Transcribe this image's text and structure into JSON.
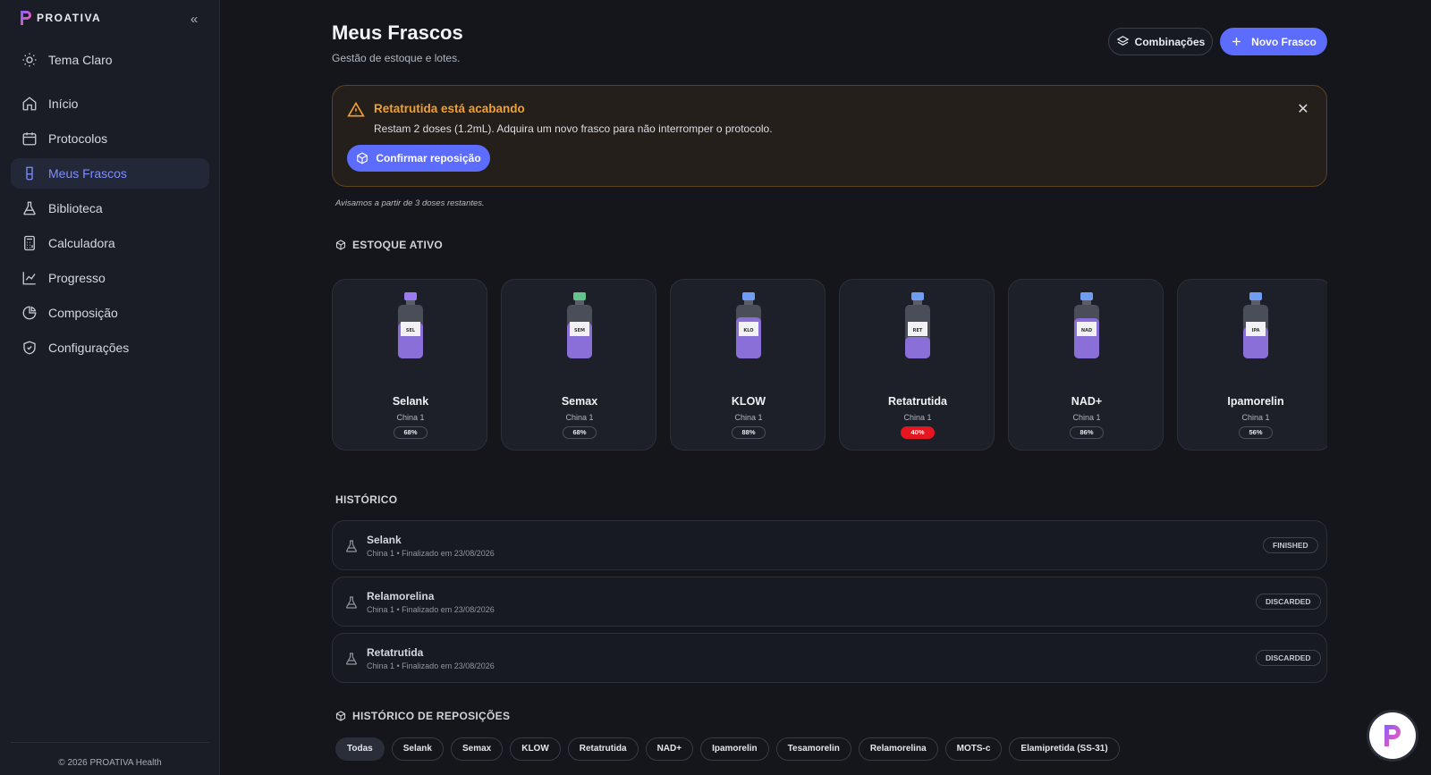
{
  "brand": {
    "name": "PROATIVA"
  },
  "sidebar": {
    "theme_toggle": "Tema Claro",
    "items": [
      {
        "label": "Início",
        "icon": "home-icon"
      },
      {
        "label": "Protocolos",
        "icon": "calendar-icon"
      },
      {
        "label": "Meus Frascos",
        "icon": "vial-icon",
        "active": true
      },
      {
        "label": "Biblioteca",
        "icon": "flask-icon"
      },
      {
        "label": "Calculadora",
        "icon": "calculator-icon"
      },
      {
        "label": "Progresso",
        "icon": "chart-line-icon"
      },
      {
        "label": "Composição",
        "icon": "pie-chart-icon"
      },
      {
        "label": "Configurações",
        "icon": "shield-icon"
      }
    ],
    "copyright": "© 2026 PROATIVA Health"
  },
  "header": {
    "title": "Meus Frascos",
    "subtitle": "Gestão de estoque e lotes.",
    "combo_button": "Combinações",
    "new_button": "Novo Frasco"
  },
  "alert": {
    "title": "Retatrutida está acabando",
    "text": "Restam 2 doses (1.2mL). Adquira um novo frasco para não interromper o protocolo.",
    "confirm_button": "Confirmar reposição",
    "note": "Avisamos a partir de 3 doses restantes.",
    "color": "#f0a02e"
  },
  "active_stock": {
    "label": "ESTOQUE ATIVO",
    "vials": [
      {
        "name": "Selank",
        "label": "SEL",
        "origin": "China 1",
        "level": "68%",
        "cap_color": "#9b7cf0",
        "low": false
      },
      {
        "name": "Semax",
        "label": "SEM",
        "origin": "China 1",
        "level": "68%",
        "cap_color": "#63c48c",
        "low": false
      },
      {
        "name": "KLOW",
        "label": "KLO",
        "origin": "China 1",
        "level": "88%",
        "cap_color": "#6f9df3",
        "low": false
      },
      {
        "name": "Retatrutida",
        "label": "RET",
        "origin": "China 1",
        "level": "40%",
        "cap_color": "#6f9df3",
        "low": true
      },
      {
        "name": "NAD+",
        "label": "NAD",
        "origin": "China 1",
        "level": "86%",
        "cap_color": "#6f9df3",
        "low": false
      },
      {
        "name": "Ipamorelin",
        "label": "IPA",
        "origin": "China 1",
        "level": "56%",
        "cap_color": "#6f9df3",
        "low": false
      }
    ]
  },
  "history": {
    "label": "HISTÓRICO",
    "rows": [
      {
        "name": "Selank",
        "sub": "China 1 • Finalizado em 23/08/2026",
        "status": "FINISHED"
      },
      {
        "name": "Relamorelina",
        "sub": "China 1 • Finalizado em 23/08/2026",
        "status": "DISCARDED"
      },
      {
        "name": "Retatrutida",
        "sub": "China 1 • Finalizado em 23/08/2026",
        "status": "DISCARDED"
      }
    ]
  },
  "restock_history": {
    "label": "HISTÓRICO DE REPOSIÇÕES",
    "filters": [
      "Todas",
      "Selank",
      "Semax",
      "KLOW",
      "Retatrutida",
      "NAD+",
      "Ipamorelin",
      "Tesamorelin",
      "Relamorelina",
      "MOTS-c",
      "Elamipretida (SS-31)"
    ],
    "active_filter": "Todas"
  },
  "colors": {
    "accent": "#5b6cff",
    "danger": "#e5161f",
    "background": "#14161c"
  }
}
